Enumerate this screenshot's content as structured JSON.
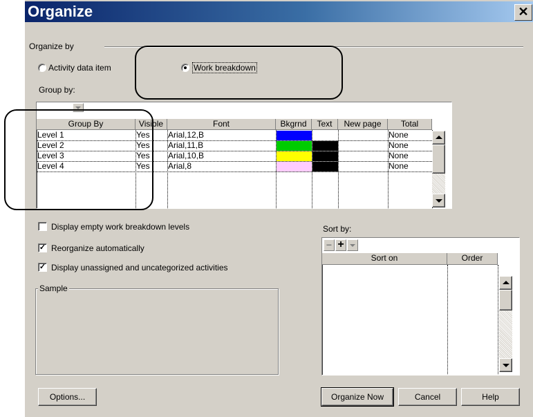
{
  "dialog": {
    "title": "Organize",
    "close_glyph": "✕"
  },
  "organize_by": {
    "label": "Organize by",
    "option_activity": "Activity data item",
    "option_work": "Work breakdown",
    "selected": "Work breakdown",
    "group_by_label": "Group by:"
  },
  "group_table": {
    "columns": [
      "Group By",
      "Visible",
      "Font",
      "Bkgrnd",
      "Text",
      "New page",
      "Total"
    ],
    "rows": [
      {
        "group_by": "Level 1",
        "visible": "Yes",
        "font": "Arial,12,B",
        "bkgrnd": "#0000ff",
        "text": "",
        "new_page": "",
        "total": "None"
      },
      {
        "group_by": "Level 2",
        "visible": "Yes",
        "font": "Arial,11,B",
        "bkgrnd": "#00cc00",
        "text": "#000000",
        "new_page": "",
        "total": "None"
      },
      {
        "group_by": "Level 3",
        "visible": "Yes",
        "font": "Arial,10,B",
        "bkgrnd": "#ffff00",
        "text": "#000000",
        "new_page": "",
        "total": "None"
      },
      {
        "group_by": "Level 4",
        "visible": "Yes",
        "font": "Arial,8",
        "bkgrnd": "#ffccff",
        "text": "#000000",
        "new_page": "",
        "total": "None"
      }
    ]
  },
  "options": {
    "display_empty": {
      "label": "Display empty work breakdown levels",
      "checked": false
    },
    "reorganize": {
      "label": "Reorganize automatically",
      "checked": true
    },
    "display_unassigned": {
      "label": "Display unassigned and uncategorized activities",
      "checked": true
    }
  },
  "sample": {
    "label": "Sample"
  },
  "sort_by": {
    "label": "Sort by:",
    "columns": [
      "Sort on",
      "Order"
    ],
    "minus": "−",
    "plus": "+"
  },
  "buttons": {
    "options": "Options...",
    "organize_now": "Organize Now",
    "cancel": "Cancel",
    "help": "Help"
  },
  "check_glyph": "✓"
}
